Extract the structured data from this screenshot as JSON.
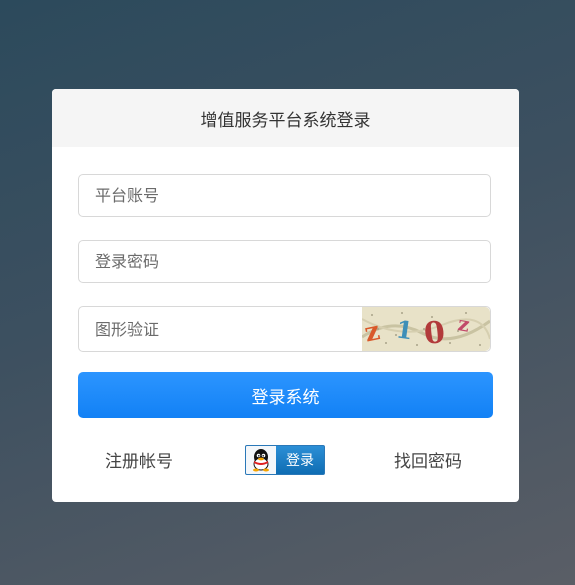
{
  "header": {
    "title": "增值服务平台系统登录"
  },
  "form": {
    "account_placeholder": "平台账号",
    "password_placeholder": "登录密码",
    "captcha_placeholder": "图形验证",
    "captcha_text": "z10z",
    "submit_label": "登录系统"
  },
  "links": {
    "register": "注册帐号",
    "qq_login": "登录",
    "recover": "找回密码"
  },
  "colors": {
    "primary": "#1a87f8",
    "qq": "#1a7cc4"
  }
}
